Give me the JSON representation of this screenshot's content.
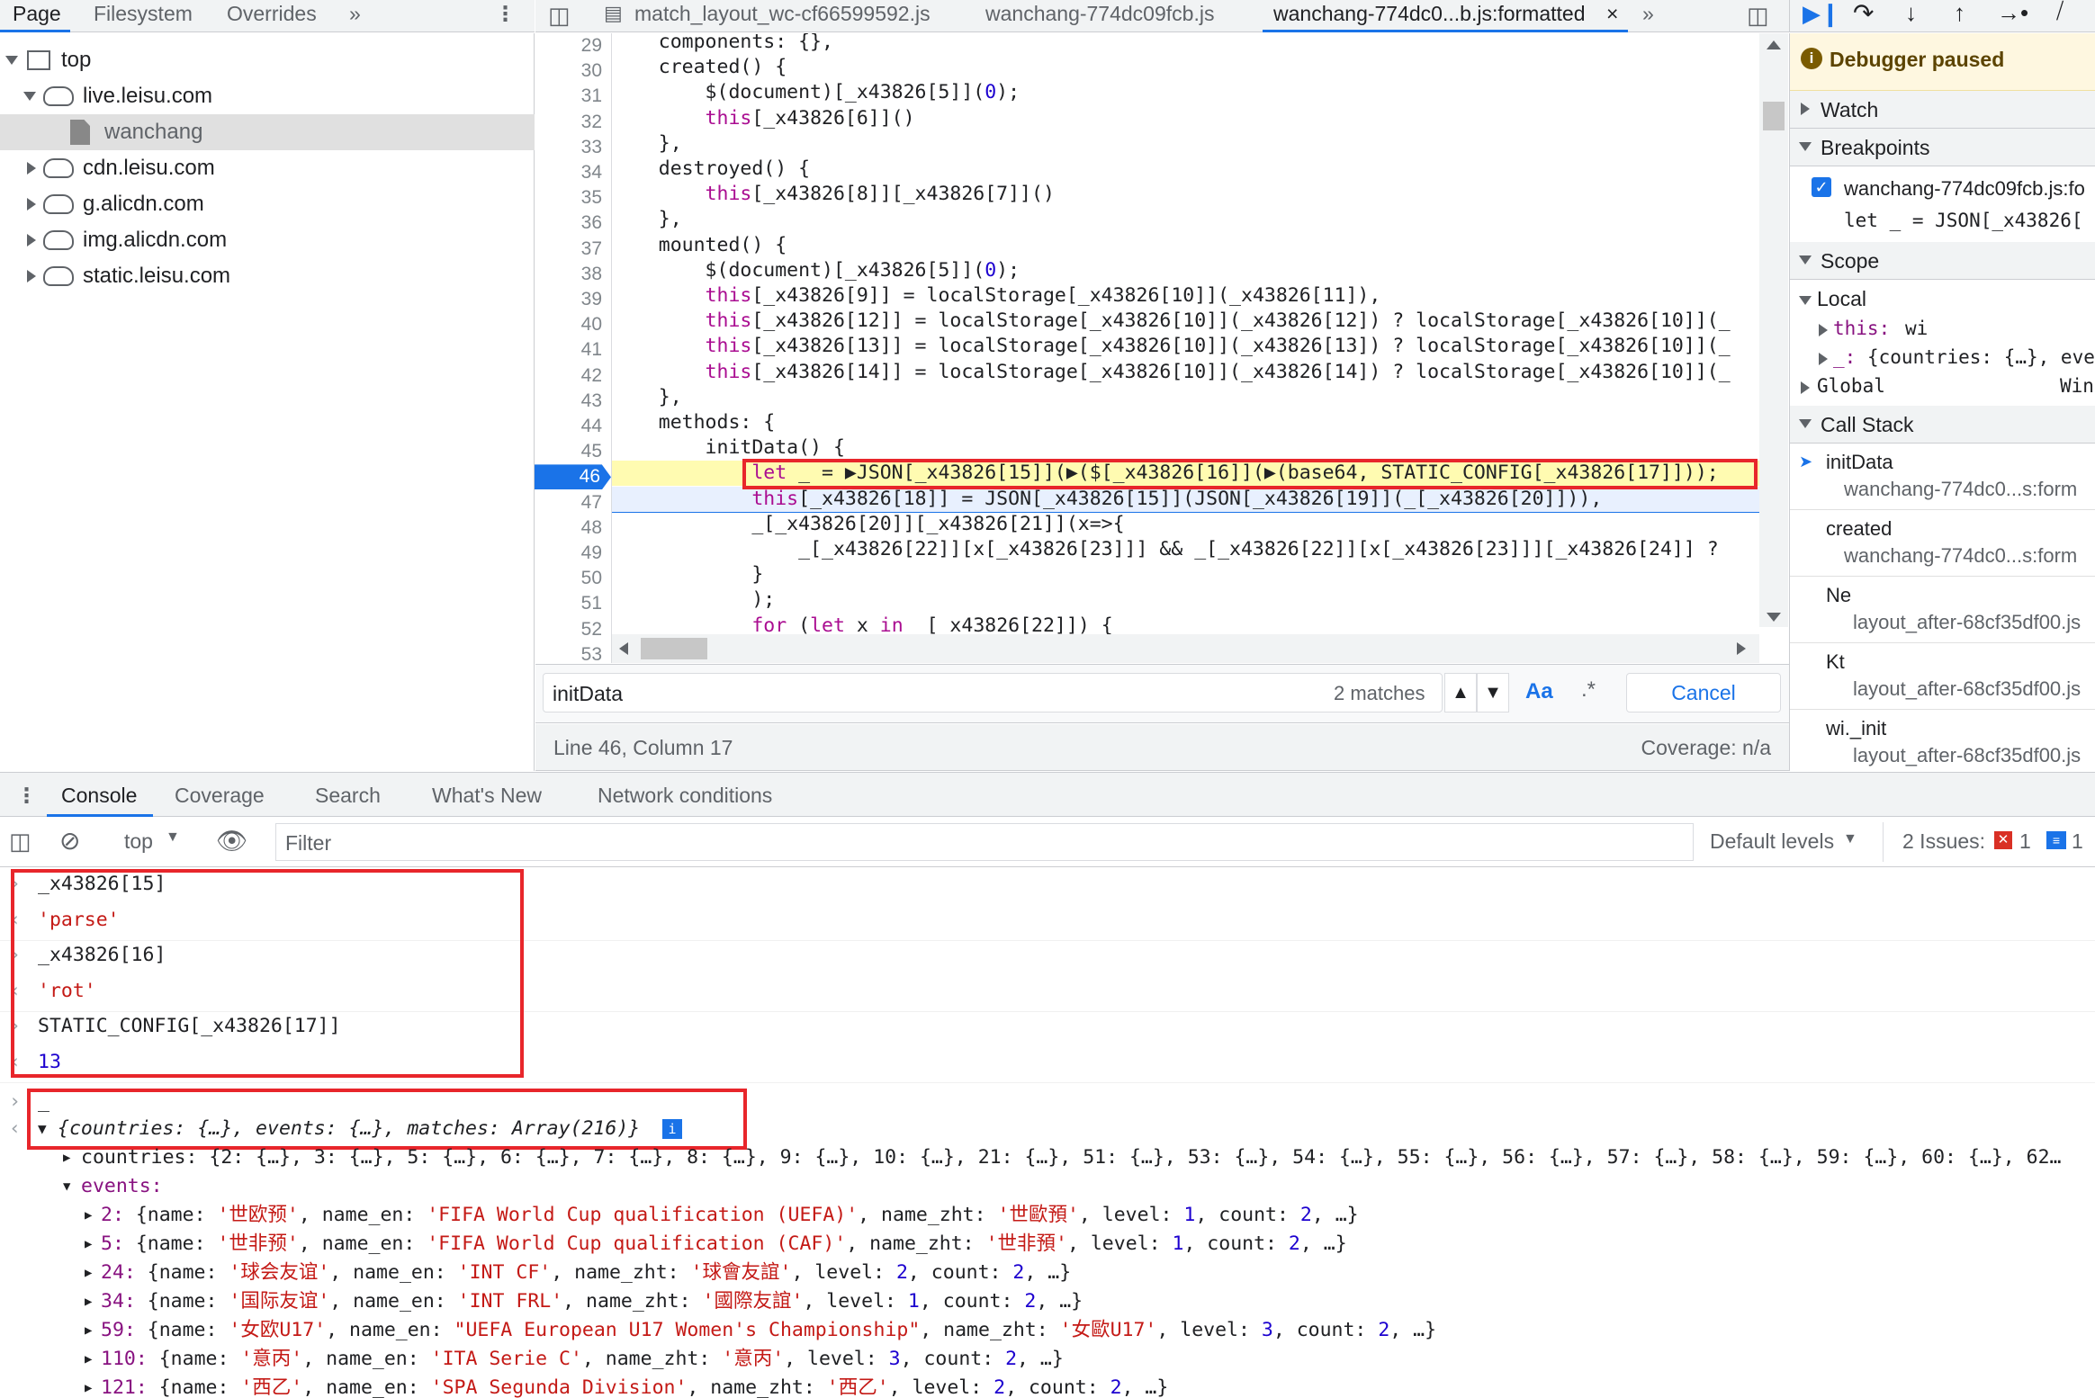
{
  "left_tabs": [
    "Page",
    "Filesystem",
    "Overrides",
    "»"
  ],
  "tree": [
    {
      "label": "top",
      "depth": 0,
      "kind": "frame"
    },
    {
      "label": "live.leisu.com",
      "depth": 1,
      "kind": "cloud"
    },
    {
      "label": "wanchang",
      "depth": 2,
      "kind": "file"
    },
    {
      "label": "cdn.leisu.com",
      "depth": 1,
      "kind": "cloud"
    },
    {
      "label": "g.alicdn.com",
      "depth": 1,
      "kind": "cloud"
    },
    {
      "label": "img.alicdn.com",
      "depth": 1,
      "kind": "cloud"
    },
    {
      "label": "static.leisu.com",
      "depth": 1,
      "kind": "cloud"
    }
  ],
  "editor_tabs": [
    "match_layout_wc-cf66599592.js",
    "wanchang-774dc09fcb.js",
    "wanchang-774dc0...b.js:formatted"
  ],
  "editor_tab_close": "×",
  "editor_tab_more": "»",
  "line_numbers": [
    "29",
    "30",
    "31",
    "32",
    "33",
    "34",
    "35",
    "36",
    "37",
    "38",
    "39",
    "40",
    "41",
    "42",
    "43",
    "44",
    "45",
    "46",
    "47",
    "48",
    "49",
    "50",
    "51",
    "52",
    "53"
  ],
  "search": {
    "query": "initData",
    "matches": "2 matches",
    "case_label": "Aa",
    "regex_label": ".*",
    "cancel": "Cancel"
  },
  "status": {
    "position": "Line 46, Column 17",
    "coverage": "Coverage: n/a"
  },
  "debugger": {
    "paused_label": "Debugger paused"
  },
  "sections": {
    "watch": "Watch",
    "breakpoints": "Breakpoints",
    "scope": "Scope",
    "call_stack": "Call Stack"
  },
  "breakpoint": {
    "file": "wanchang-774dc09fcb.js:fo",
    "code": "let _ = JSON[_x43826["
  },
  "scope": {
    "local": "Local",
    "this_key": "this:",
    "this_val": "wi",
    "underscore_key": "_:",
    "underscore_val": "{countries: {…}, eve",
    "global": "Global",
    "global_val": "Win"
  },
  "call_stack": [
    {
      "fn": "initData",
      "loc": "wanchang-774dc0...s:form",
      "current": true
    },
    {
      "fn": "created",
      "loc": "wanchang-774dc0...s:form",
      "current": false
    },
    {
      "fn": "Ne",
      "loc": "layout_after-68cf35df00.js",
      "current": false
    },
    {
      "fn": "Kt",
      "loc": "layout_after-68cf35df00.js",
      "current": false
    },
    {
      "fn": "wi._init",
      "loc": "layout_after-68cf35df00.js",
      "current": false
    }
  ],
  "console_tabs": [
    "Console",
    "Coverage",
    "Search",
    "What's New",
    "Network conditions"
  ],
  "console_toolbar": {
    "context": "top",
    "filter_placeholder": "Filter",
    "levels": "Default levels",
    "issues_label": "2 Issues:",
    "issues_err": "1",
    "issues_info": "1"
  },
  "console_entries": [
    {
      "kind": "in",
      "text": "_x43826[15]"
    },
    {
      "kind": "out-str",
      "text": "'parse'"
    },
    {
      "kind": "in",
      "text": "_x43826[16]"
    },
    {
      "kind": "out-str",
      "text": "'rot'"
    },
    {
      "kind": "in",
      "text": "STATIC_CONFIG[_x43826[17]]"
    },
    {
      "kind": "out-num",
      "text": "13"
    }
  ],
  "console_obj": {
    "input": "_",
    "summary": "{countries: {…}, events: {…}, matches: Array(216)}",
    "countries_row": "countries: {2: {…}, 3: {…}, 5: {…}, 6: {…}, 7: {…}, 8: {…}, 9: {…}, 10: {…}, 21: {…}, 51: {…}, 53: {…}, 54: {…}, 55: {…}, 56: {…}, 57: {…}, 58: {…}, 59: {…}, 60: {…}, 62…",
    "events_label": "events:",
    "events": [
      {
        "id": "2",
        "name": "'世欧预'",
        "name_en": "'FIFA World Cup qualification (UEFA)'",
        "name_zht": "'世歐預'",
        "level": "1",
        "count": "2"
      },
      {
        "id": "5",
        "name": "'世非预'",
        "name_en": "'FIFA World Cup qualification (CAF)'",
        "name_zht": "'世非預'",
        "level": "1",
        "count": "2"
      },
      {
        "id": "24",
        "name": "'球会友谊'",
        "name_en": "'INT CF'",
        "name_zht": "'球會友誼'",
        "level": "2",
        "count": "2"
      },
      {
        "id": "34",
        "name": "'国际友谊'",
        "name_en": "'INT FRL'",
        "name_zht": "'國際友誼'",
        "level": "1",
        "count": "2"
      },
      {
        "id": "59",
        "name": "'女欧U17'",
        "name_en": "\"UEFA European U17 Women's Championship\"",
        "name_zht": "'女歐U17'",
        "level": "3",
        "count": "2"
      },
      {
        "id": "110",
        "name": "'意丙'",
        "name_en": "'ITA Serie C'",
        "name_zht": "'意丙'",
        "level": "3",
        "count": "2"
      },
      {
        "id": "121",
        "name": "'西乙'",
        "name_en": "'SPA Segunda Division'",
        "name_zht": "'西乙'",
        "level": "2",
        "count": "2"
      }
    ]
  },
  "colors": {
    "accent": "#1a73e8",
    "highlight": "#e8262b",
    "paused": "#fef7e0",
    "exec_line": "#fffbb1"
  }
}
